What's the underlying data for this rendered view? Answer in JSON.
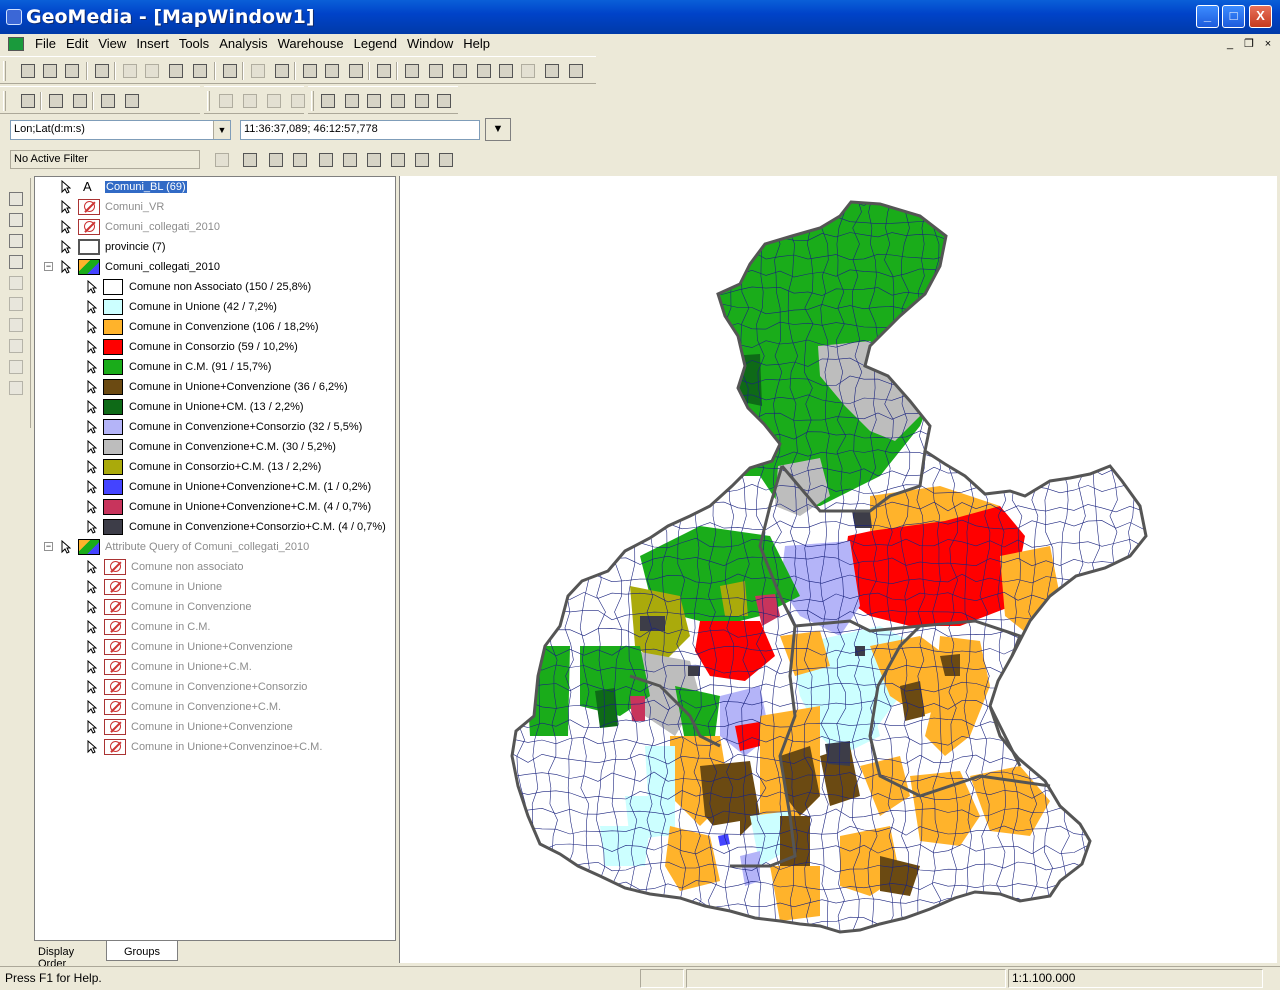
{
  "window": {
    "title": "GeoMedia - [MapWindow1]",
    "controls": {
      "minimize": "_",
      "maximize": "□",
      "close": "X"
    }
  },
  "menubar": {
    "items": [
      "File",
      "Edit",
      "View",
      "Insert",
      "Tools",
      "Analysis",
      "Warehouse",
      "Legend",
      "Window",
      "Help"
    ],
    "mdi_controls": {
      "minimize": "_",
      "restore": "❐",
      "close": "×"
    }
  },
  "coordinates": {
    "system": "Lon;Lat(d:m:s)",
    "readout": "11:36:37,089; 46:12:57,778"
  },
  "filter": {
    "status": "No Active Filter"
  },
  "legend": {
    "entries": [
      {
        "label": "Comuni_BL (69)",
        "style": "selected",
        "icon": "text-label-icon"
      },
      {
        "label": "Comuni_VR",
        "style": "dim",
        "icon": "not-displayed-icon"
      },
      {
        "label": "Comuni_collegati_2010",
        "style": "dim",
        "icon": "not-displayed-icon"
      },
      {
        "label": "provincie (7)",
        "style": "normal",
        "icon": "area-outline-icon"
      },
      {
        "label": "Comuni_collegati_2010",
        "style": "normal",
        "icon": "thematic-icon",
        "expanded": true
      }
    ],
    "thematic_classes": [
      {
        "label": "Comune non Associato (150 / 25,8%)",
        "color": "#ffffff"
      },
      {
        "label": "Comune in Unione (42 / 7,2%)",
        "color": "#ccffff"
      },
      {
        "label": "Comune in Convenzione (106 / 18,2%)",
        "color": "#ffb32b"
      },
      {
        "label": "Comune in Consorzio (59 / 10,2%)",
        "color": "#ff0000"
      },
      {
        "label": "Comune in C.M. (91 / 15,7%)",
        "color": "#1aac1a"
      },
      {
        "label": "Comune in Unione+Convenzione (36 / 6,2%)",
        "color": "#6b4a12"
      },
      {
        "label": "Comune in Unione+CM. (13 / 2,2%)",
        "color": "#0e6a17"
      },
      {
        "label": "Comune in Convenzione+Consorzio (32 / 5,5%)",
        "color": "#b4b4f8"
      },
      {
        "label": "Comune in Convenzione+C.M. (30 / 5,2%)",
        "color": "#bdbdbd"
      },
      {
        "label": "Comune in Consorzio+C.M. (13 / 2,2%)",
        "color": "#aaaa0b"
      },
      {
        "label": "Comune in Unione+Convenzione+C.M. (1 / 0,2%)",
        "color": "#4444ff"
      },
      {
        "label": "Comune in Unione+Convenzione+C.M. (4 / 0,7%)",
        "color": "#c8345c"
      },
      {
        "label": "Comune in Convenzione+Consorzio+C.M. (4 / 0,7%)",
        "color": "#3d3d48"
      }
    ],
    "query_group": {
      "label": "Attribute Query of Comuni_collegati_2010",
      "style": "dim"
    },
    "query_items": [
      "Comune non associato",
      "Comune in Unione",
      "Comune in Convenzione",
      "Comune in C.M.",
      "Comune in Unione+Convenzione",
      "Comune in Unione+C.M.",
      "Comune in Convenzione+Consorzio",
      "Comune in Convenzione+C.M.",
      "Comune in Unione+Convenzione",
      "Comune in Unione+Convenzinoe+C.M."
    ]
  },
  "tabs": {
    "display_order": "Display Order",
    "groups": "Groups"
  },
  "status": {
    "help": "Press F1 for Help.",
    "scale": "1:1.100.000"
  },
  "colors": {
    "titlebar": "#0043c9",
    "selection": "#316ac5",
    "province_border": "#555555",
    "municipality_border": "#1a237e"
  }
}
